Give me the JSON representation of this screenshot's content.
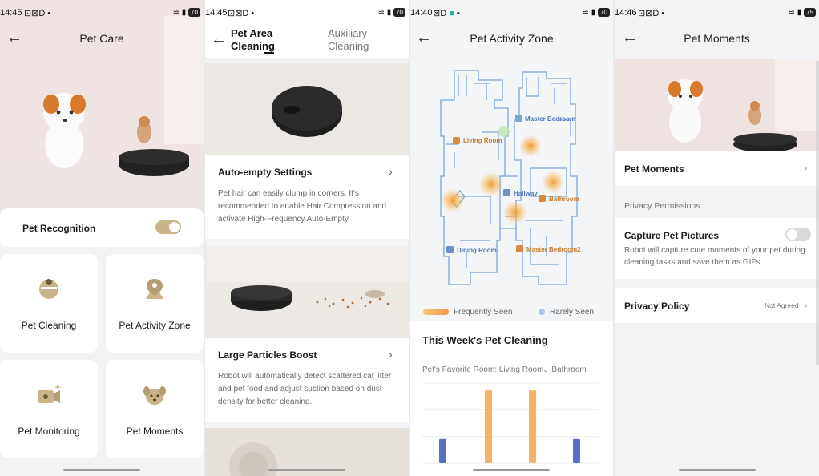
{
  "screen1": {
    "status": {
      "time": "14:45",
      "battery": "70"
    },
    "title": "Pet Care",
    "pet_recognition": {
      "label": "Pet Recognition",
      "enabled": true
    },
    "tiles": [
      {
        "label": "Pet Cleaning",
        "icon": "robot-vacuum-icon"
      },
      {
        "label": "Pet Activity Zone",
        "icon": "location-pin-icon"
      },
      {
        "label": "Pet Monitoring",
        "icon": "camera-sparkle-icon"
      },
      {
        "label": "Pet Moments",
        "icon": "dog-face-icon"
      }
    ],
    "accent": "#c9b489"
  },
  "screen2": {
    "status": {
      "time": "14:45",
      "battery": "70"
    },
    "tabs": [
      {
        "label": "Pet Area Cleaning",
        "active": true
      },
      {
        "label": "Auxiliary Cleaning",
        "active": false
      }
    ],
    "sections": [
      {
        "title": "Auto-empty Settings",
        "text": "Pet hair can easily clump in corners. It's recommended to enable Hair Compression and activate High-Frequency Auto-Empty."
      },
      {
        "title": "Large Particles Boost",
        "text": "Robot will automatically detect scattered cat litter and pet food and adjust suction based on dust density for better cleaning."
      }
    ]
  },
  "screen3": {
    "status": {
      "time": "14:40",
      "battery": "70"
    },
    "title": "Pet Activity Zone",
    "rooms": [
      "Master Bedroom",
      "Living Room",
      "Hallway",
      "Bathroom",
      "Dining Room",
      "Master Bedroom2"
    ],
    "legend": {
      "frequent": "Frequently Seen",
      "rare": "Rarely Seen"
    },
    "weekly_title": "This Week's Pet Cleaning",
    "favorite_room": "Pet's Favorite Room: Living Room、Bathroom",
    "colors": {
      "frequent": "#f2a641",
      "rare": "#5670c9",
      "map_line": "#7aa7d9"
    },
    "chart_data": {
      "type": "bar",
      "series": [
        {
          "color": "#5670c9",
          "values": [
            1,
            0,
            0,
            1
          ]
        },
        {
          "color": "#f5b262",
          "values": [
            0,
            3,
            3,
            0
          ]
        }
      ],
      "ylim": [
        0,
        3.3
      ]
    }
  },
  "screen4": {
    "status": {
      "time": "14:46",
      "battery": "75"
    },
    "title": "Pet Moments",
    "moments_label": "Pet Moments",
    "privacy_header": "Privacy Permissions",
    "capture": {
      "label": "Capture Pet Pictures",
      "text": "Robot will capture cute moments of your pet during cleaning tasks and save them as GIFs.",
      "enabled": false
    },
    "policy": {
      "label": "Privacy Policy",
      "status": "Not Agreed"
    }
  }
}
